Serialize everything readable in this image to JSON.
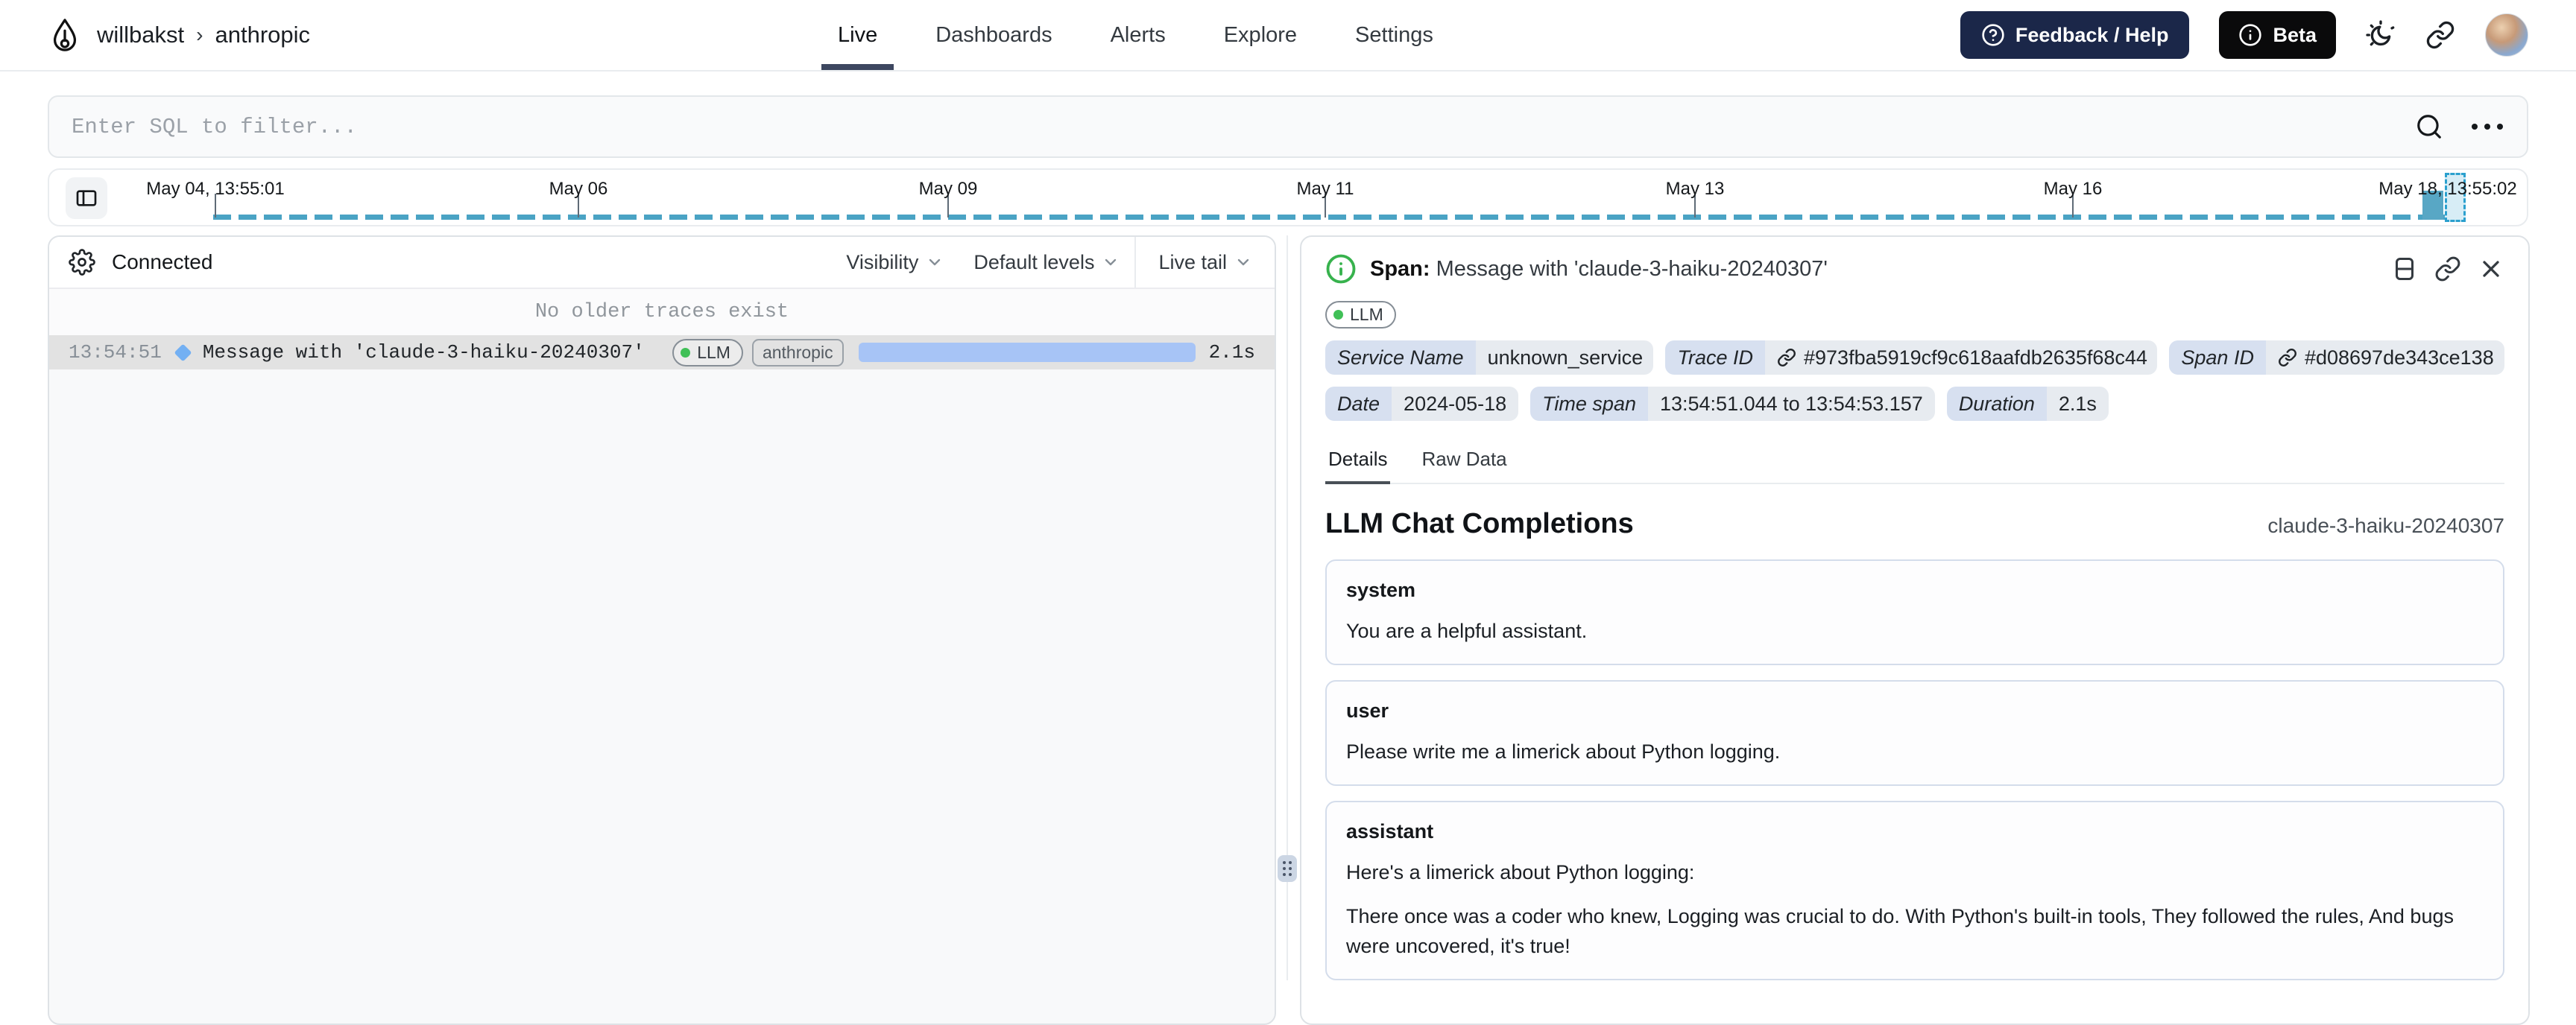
{
  "header": {
    "breadcrumb": {
      "org": "willbakst",
      "separator": "›",
      "project": "anthropic"
    },
    "tabs": [
      {
        "label": "Live",
        "active": true
      },
      {
        "label": "Dashboards",
        "active": false
      },
      {
        "label": "Alerts",
        "active": false
      },
      {
        "label": "Explore",
        "active": false
      },
      {
        "label": "Settings",
        "active": false
      }
    ],
    "feedback_button": "Feedback / Help",
    "beta_button": "Beta"
  },
  "filter": {
    "placeholder": "Enter SQL to filter..."
  },
  "timeline": {
    "ticks": [
      "May 04, 13:55:01",
      "May 06",
      "May 09",
      "May 11",
      "May 13",
      "May 16",
      "May 18, 13:55:02"
    ],
    "colors": {
      "dash": "#4aa3c4",
      "bar": "#58a7c5",
      "selection_fill": "#d7edf6",
      "selection_border": "#2ba0ce"
    }
  },
  "left_panel": {
    "status": "Connected",
    "controls": [
      "Visibility",
      "Default levels",
      "Live tail"
    ],
    "empty_notice": "No older traces exist",
    "trace": {
      "time": "13:54:51",
      "title": "Message with 'claude-3-haiku-20240307'",
      "badges": [
        "LLM",
        "anthropic"
      ],
      "duration": "2.1s",
      "bar_color": "#a7c4f6",
      "diamond_color": "#73b0f3"
    }
  },
  "span_panel": {
    "header_label": "Span:",
    "title": "Message with 'claude-3-haiku-20240307'",
    "tag": "LLM",
    "meta": [
      {
        "label": "Service Name",
        "value": "unknown_service",
        "link": false
      },
      {
        "label": "Trace ID",
        "value": "#973fba5919cf9c618aafdb2635f68c44",
        "link": true
      },
      {
        "label": "Span ID",
        "value": "#d08697de343ce138",
        "link": true
      },
      {
        "label": "Date",
        "value": "2024-05-18",
        "link": false
      },
      {
        "label": "Time span",
        "value": "13:54:51.044 to 13:54:53.157",
        "link": false
      },
      {
        "label": "Duration",
        "value": "2.1s",
        "link": false
      }
    ],
    "tabs": [
      {
        "label": "Details",
        "active": true
      },
      {
        "label": "Raw Data",
        "active": false
      }
    ],
    "section_title": "LLM Chat Completions",
    "model": "claude-3-haiku-20240307",
    "messages": [
      {
        "role": "system",
        "content": [
          "You are a helpful assistant."
        ]
      },
      {
        "role": "user",
        "content": [
          "Please write me a limerick about Python logging."
        ]
      },
      {
        "role": "assistant",
        "content": [
          "Here's a limerick about Python logging:",
          "There once was a coder who knew, Logging was crucial to do. With Python's built-in tools, They followed the rules, And bugs were uncovered, it's true!"
        ]
      }
    ],
    "status_green": "#37b24d"
  }
}
